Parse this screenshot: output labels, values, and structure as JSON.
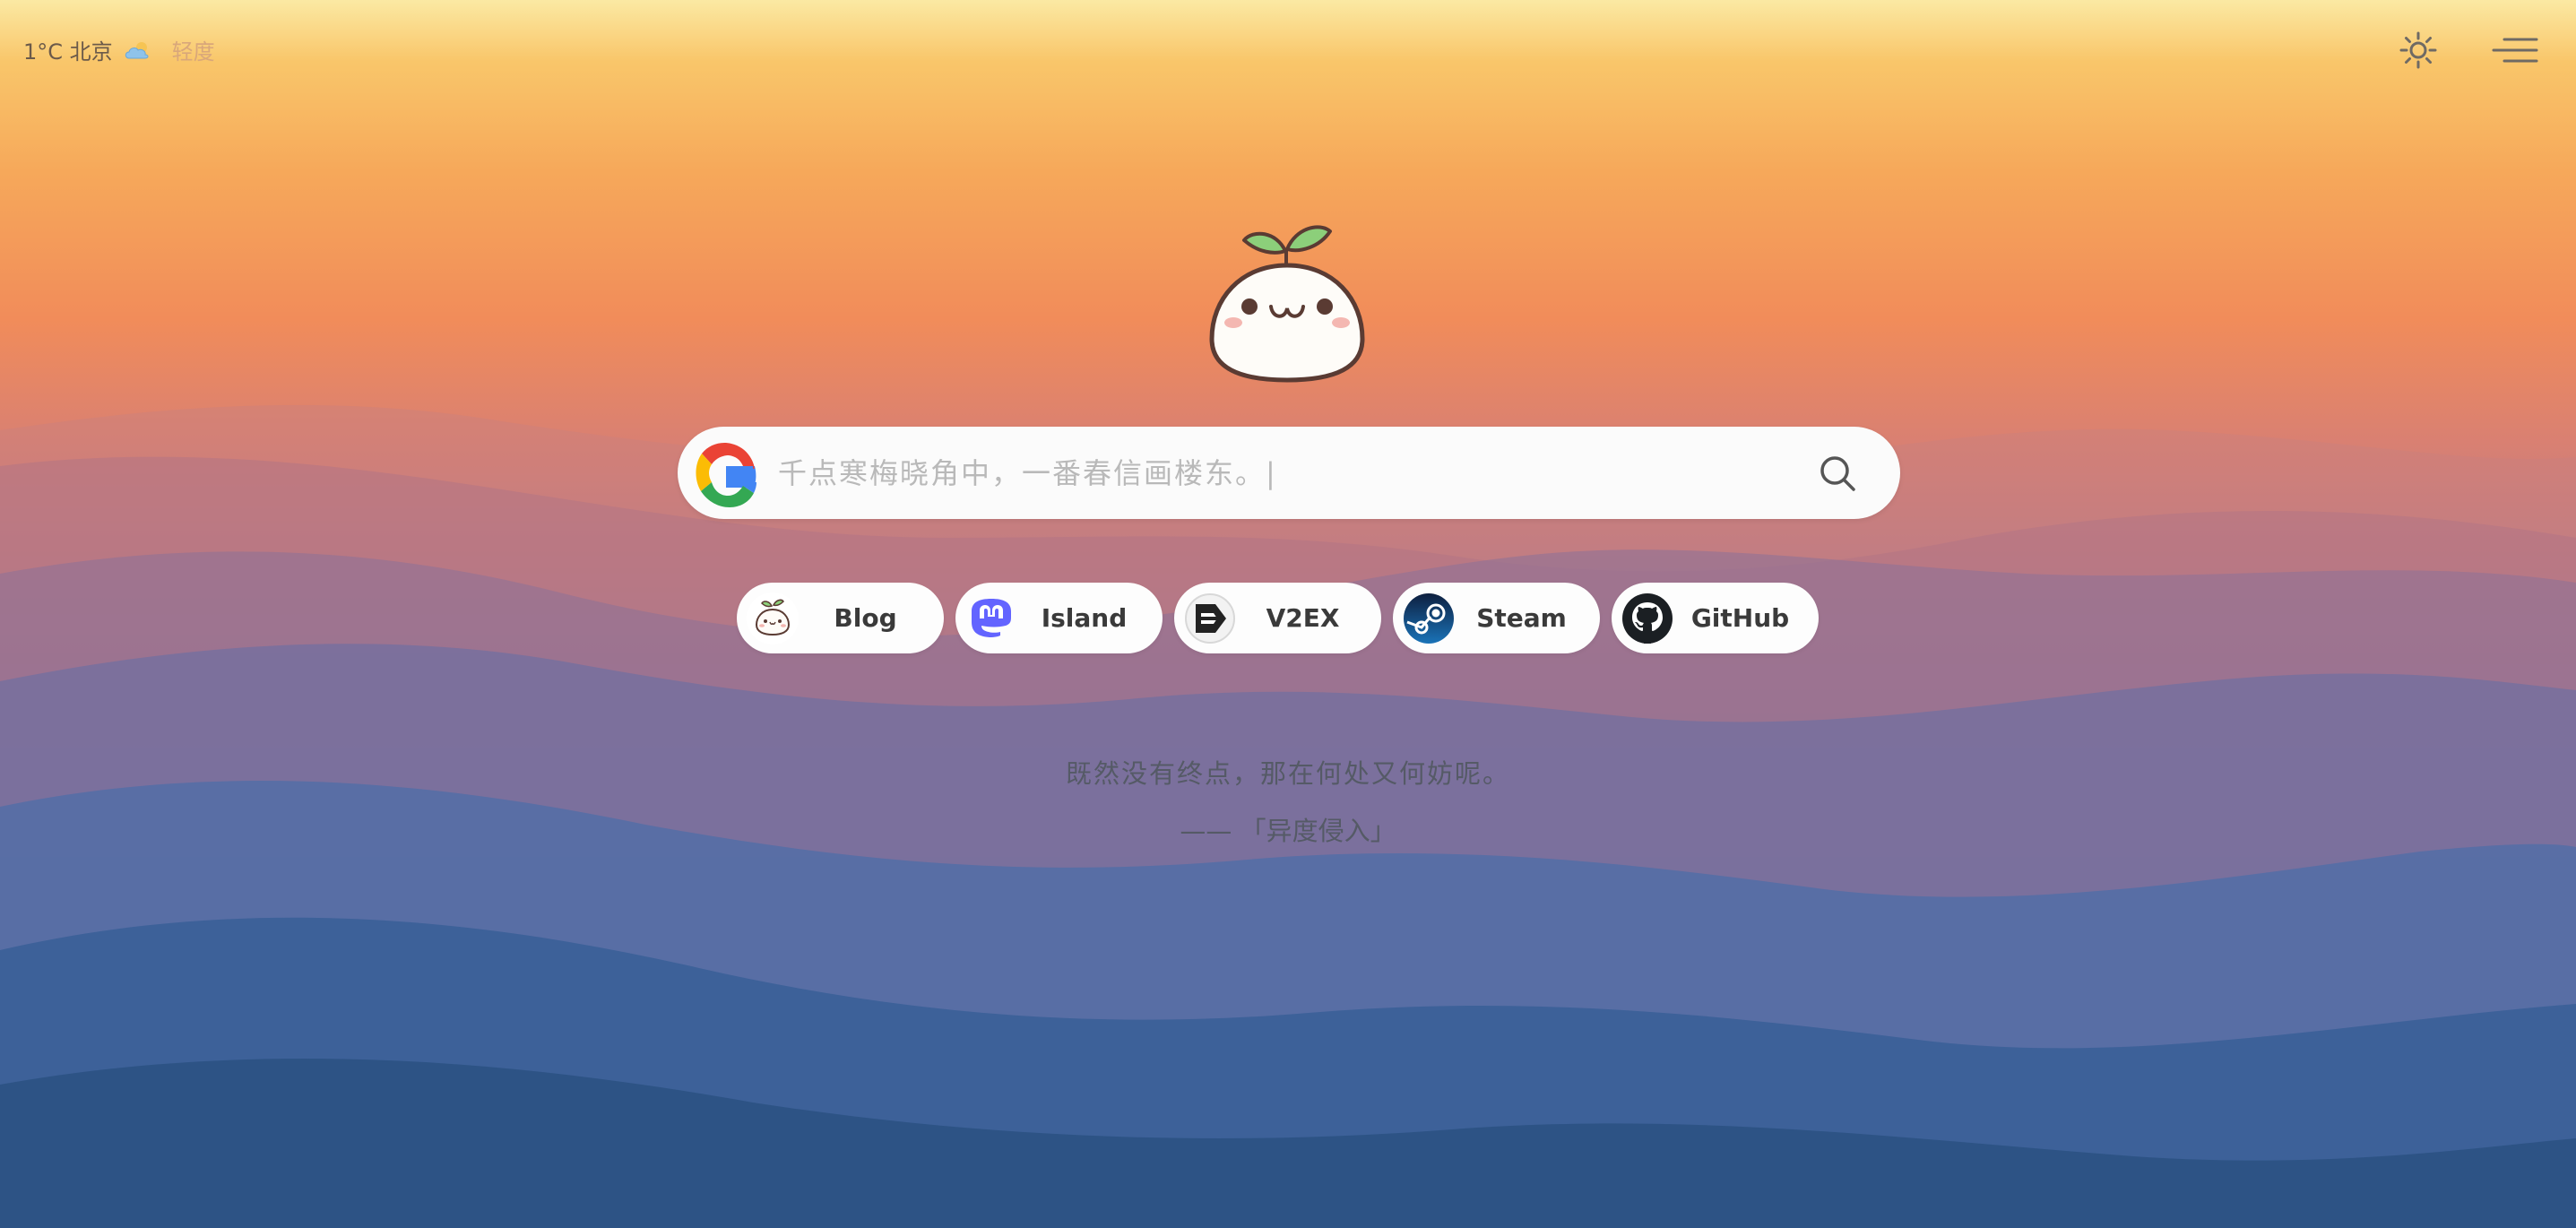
{
  "weather": {
    "text": "1°C 北京",
    "icon": "cloud-icon"
  },
  "search_engine": {
    "name": "轻度",
    "logo": "google-logo"
  },
  "toolbar": {
    "theme_icon": "sun-icon",
    "menu_icon": "menu-icon"
  },
  "logo": {
    "icon": "sprout-mascot-logo"
  },
  "search": {
    "placeholder": "千点寒梅晓角中，一番春信画楼东。|",
    "value": "",
    "button_icon": "search-icon"
  },
  "links": [
    {
      "label": "Blog",
      "icon": "mascot-icon"
    },
    {
      "label": "Island",
      "icon": "mastodon-icon"
    },
    {
      "label": "V2EX",
      "icon": "v2ex-icon"
    },
    {
      "label": "Steam",
      "icon": "steam-icon"
    },
    {
      "label": "GitHub",
      "icon": "github-icon"
    }
  ],
  "quote": {
    "text": "既然没有终点，那在何处又何妨呢。",
    "from": "—— 「异度侵入」"
  },
  "colors": {
    "sky_top": "#fbe9a3",
    "sunset_orange": "#f18c5a",
    "mountain_blue": "#2f5c95",
    "engine_name": "#d9a77a"
  }
}
